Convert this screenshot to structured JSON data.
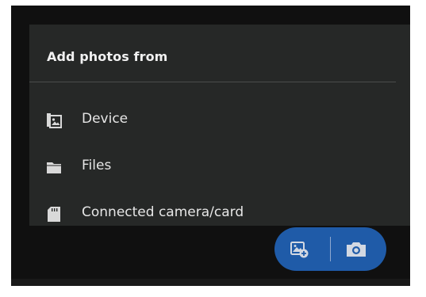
{
  "menu": {
    "title": "Add photos from",
    "items": [
      {
        "label": "Device",
        "icon": "device-gallery-icon"
      },
      {
        "label": "Files",
        "icon": "folder-icon"
      },
      {
        "label": "Connected camera/card",
        "icon": "sd-card-icon"
      }
    ]
  },
  "fab": {
    "left_icon": "add-photo-icon",
    "right_icon": "camera-icon",
    "color": "#1f5ba8"
  },
  "colors": {
    "background": "#101010",
    "menu_background": "#262827",
    "text": "#e6e6e6"
  }
}
